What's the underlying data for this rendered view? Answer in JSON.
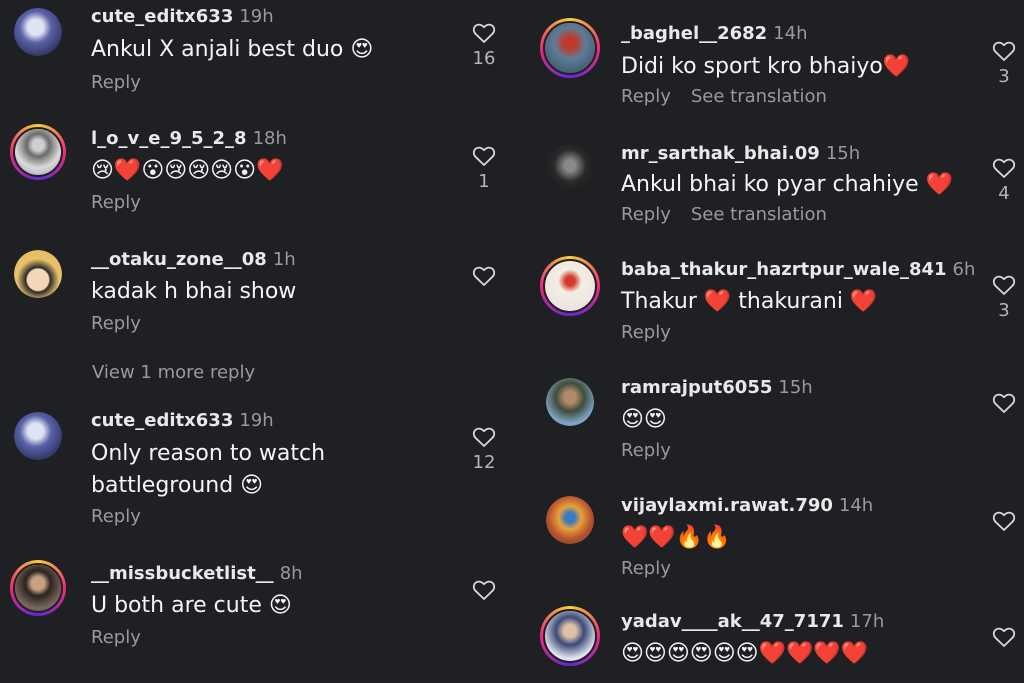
{
  "left_comments": [
    {
      "user": "cute_editx633",
      "time": "19h",
      "text": "Ankul X anjali best duo 😍",
      "actions": [
        "Reply"
      ],
      "likes": "16"
    },
    {
      "user": "l_o_v_e_9_5_2_8",
      "time": "18h",
      "text": "😢❤️😮😢😢😢😮❤️",
      "actions": [
        "Reply"
      ],
      "likes": "1"
    },
    {
      "user": "__otaku_zone__08",
      "time": "1h",
      "text": "kadak h bhai show",
      "actions": [
        "Reply"
      ],
      "likes": ""
    },
    {
      "user": "cute_editx633",
      "time": "19h",
      "text": "Only reason to watch battleground 😍",
      "actions": [
        "Reply"
      ],
      "likes": "12"
    },
    {
      "user": "__missbucketlist__",
      "time": "8h",
      "text": "U both are cute 😍",
      "actions": [
        "Reply"
      ],
      "likes": ""
    }
  ],
  "view_more": "View 1 more reply",
  "right_comments": [
    {
      "user": "_baghel__2682",
      "time": "14h",
      "text": "Didi ko sport kro bhaiyo❤️",
      "actions": [
        "Reply",
        "See translation"
      ],
      "likes": "3"
    },
    {
      "user": "mr_sarthak_bhai.09",
      "time": "15h",
      "text": "Ankul bhai ko pyar chahiye ❤️",
      "actions": [
        "Reply",
        "See translation"
      ],
      "likes": "4"
    },
    {
      "user": "baba_thakur_hazrtpur_wale_841",
      "time": "6h",
      "text": "Thakur ❤️ thakurani ❤️",
      "actions": [
        "Reply"
      ],
      "likes": "3"
    },
    {
      "user": "ramrajput6055",
      "time": "15h",
      "text": "😍😍",
      "actions": [
        "Reply"
      ],
      "likes": ""
    },
    {
      "user": "vijaylaxmi.rawat.790",
      "time": "14h",
      "text": "❤️❤️🔥🔥",
      "actions": [
        "Reply"
      ],
      "likes": ""
    },
    {
      "user": "yadav____ak__47_7171",
      "time": "17h",
      "text": "😍😍😍😍😍😍❤️❤️❤️❤️",
      "actions": [
        "Reply"
      ],
      "likes": ""
    }
  ],
  "colors": {
    "background": "#1f2024",
    "text": "#f5f5f5",
    "muted": "#9a9a9a"
  }
}
